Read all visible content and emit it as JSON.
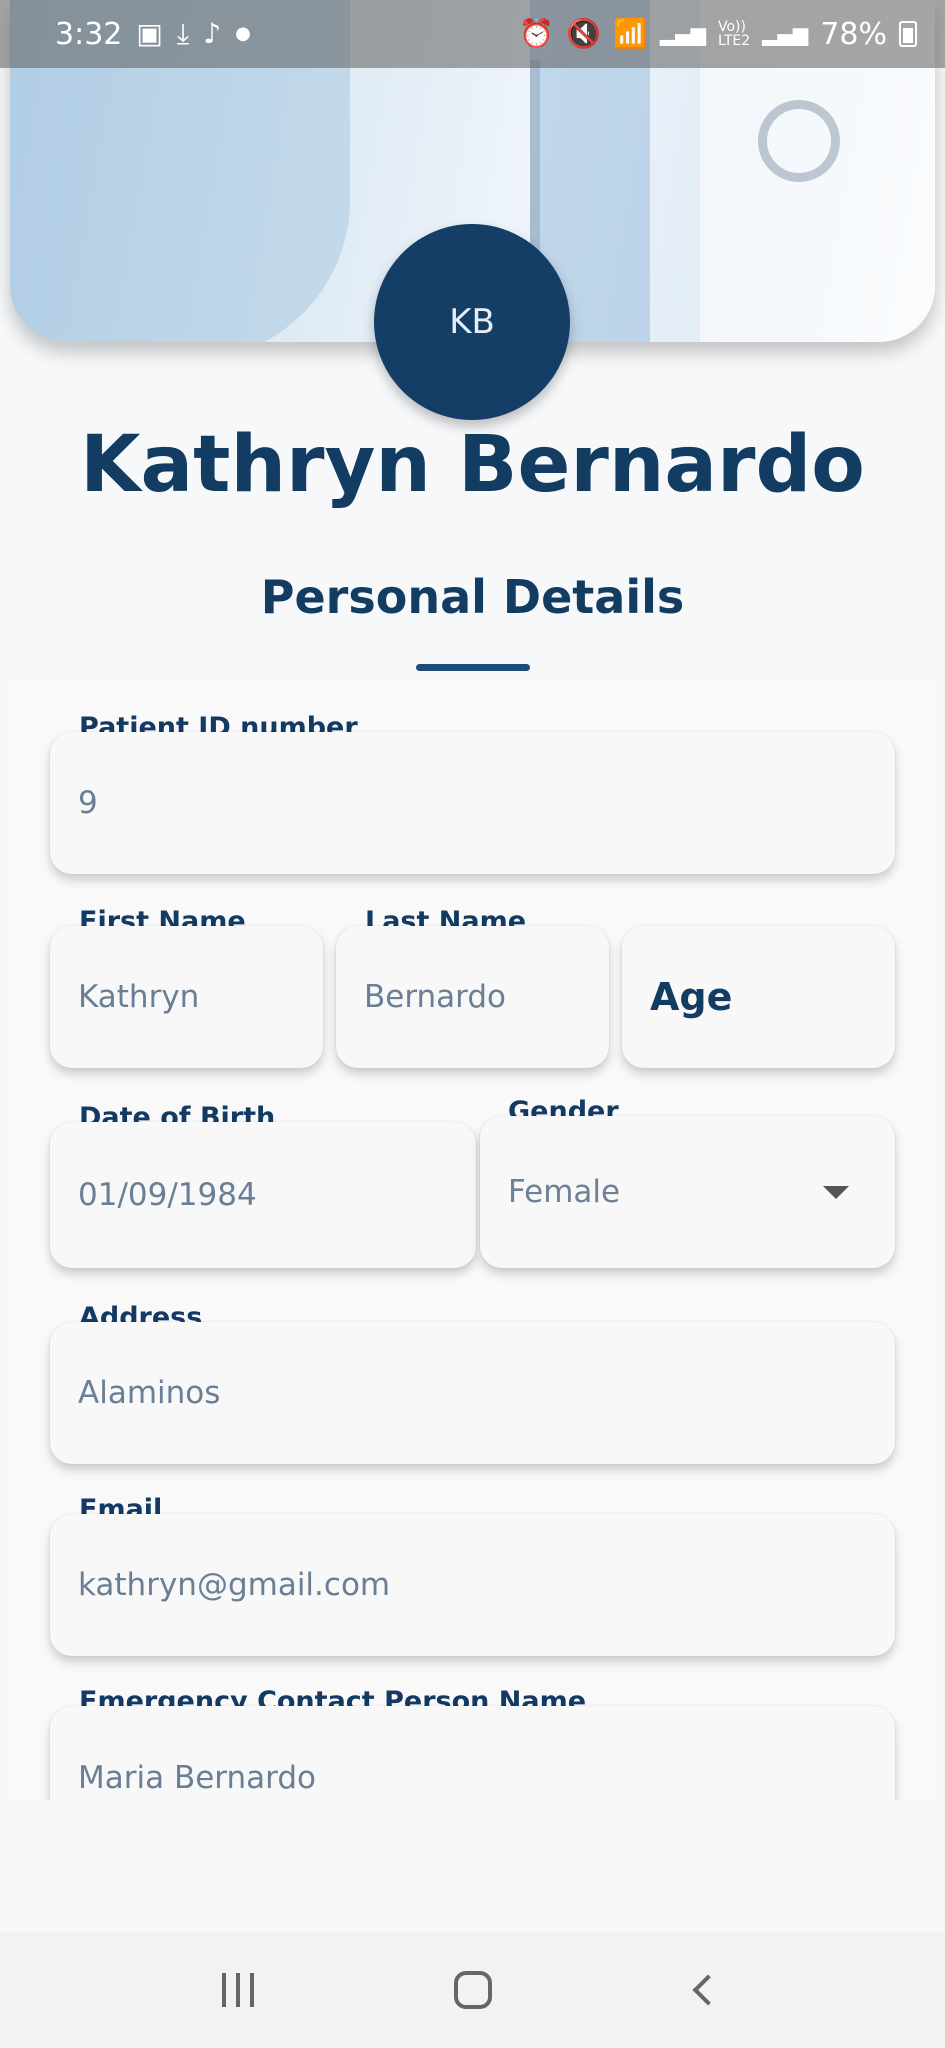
{
  "status_bar": {
    "time": "3:32",
    "battery": "78%",
    "left_icons": [
      "gallery-icon",
      "download-icon",
      "tiktok-icon",
      "dot-icon"
    ],
    "right_icons": [
      "alarm-icon",
      "mute-icon",
      "wifi-icon",
      "signal-icon",
      "volte-icon",
      "signal2-icon",
      "battery-icon"
    ],
    "volte_label": "Vo))\nLTE2"
  },
  "profile": {
    "initials": "KB",
    "name": "Kathryn Bernardo"
  },
  "section": {
    "title": "Personal Details"
  },
  "form": {
    "patient_id": {
      "label": "Patient ID number",
      "value": "9"
    },
    "first_name": {
      "label": "First Name",
      "value": "Kathryn"
    },
    "last_name": {
      "label": "Last Name",
      "value": "Bernardo"
    },
    "age": {
      "value": "Age"
    },
    "dob": {
      "label": "Date of Birth",
      "value": "01/09/1984"
    },
    "gender": {
      "label": "Gender",
      "value": "Female"
    },
    "address": {
      "label": "Address",
      "value": "Alaminos"
    },
    "email": {
      "label": "Email",
      "value": "kathryn@gmail.com"
    },
    "emergency_name": {
      "label": "Emergency Contact Person Name",
      "value": "Maria Bernardo"
    }
  },
  "colors": {
    "primary": "#133c63",
    "field_text": "#6a7f95",
    "background": "#f7f8fa"
  }
}
